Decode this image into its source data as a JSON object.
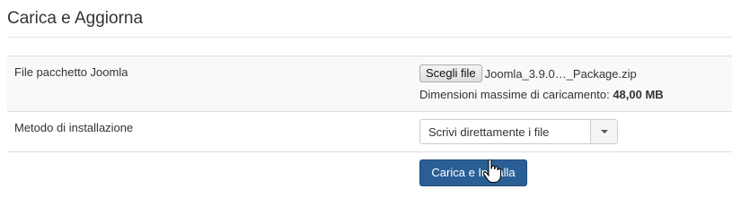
{
  "header": {
    "title": "Carica e Aggiorna"
  },
  "form": {
    "file_row": {
      "label": "File pacchetto Joomla",
      "choose_button": "Scegli file",
      "file_name": "Joomla_3.9.0…_Package.zip",
      "max_size_label": "Dimensioni massime di caricamento:",
      "max_size_value": "48,00 MB"
    },
    "method_row": {
      "label": "Metodo di installazione",
      "selected_option": "Scrivi direttamente i file"
    },
    "submit": {
      "label": "Carica e Installa"
    }
  },
  "colors": {
    "primary_button": "#2a5f96",
    "row_alt_background": "#f9f9f9",
    "border": "#dddddd"
  },
  "icons": {
    "cursor": "hand-pointer-icon",
    "dropdown": "caret-down-icon"
  }
}
